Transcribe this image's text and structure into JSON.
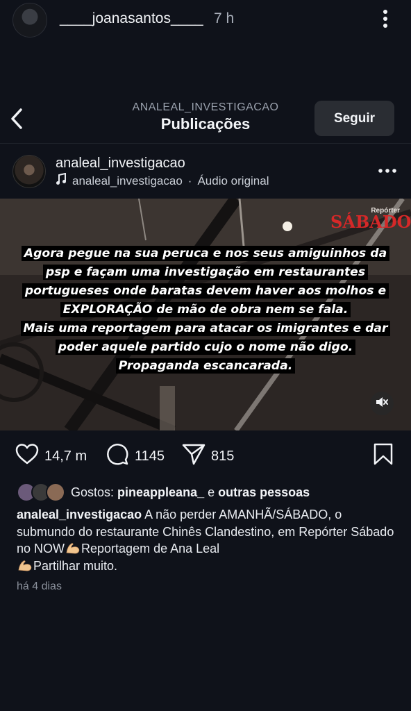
{
  "story": {
    "username": "____joanasantos____",
    "time": "7 h"
  },
  "screen": {
    "account": "ANALEAL_INVESTIGACAO",
    "title": "Publicações",
    "follow_label": "Seguir"
  },
  "post": {
    "username": "analeal_investigacao",
    "audio_user": "analeal_investigacao",
    "audio_label": "Áudio original",
    "brand_small": "Repórter",
    "brand_main": "SÁBADO",
    "overlay_lines": [
      "Agora pegue na sua peruca e nos seus amiguinhos da",
      "psp e façam uma investigação em  restaurantes",
      "portugueses onde baratas devem  haver aos molhos e",
      "EXPLORAÇÃO de mão de obra nem se fala.",
      "Mais uma reportagem para atacar os imigrantes e dar",
      "poder aquele partido cujo o nome não digo.",
      "Propaganda escancarada."
    ],
    "likes_count": "14,7 m",
    "comments_count": "1145",
    "shares_count": "815",
    "likes_prefix": "Gostos:",
    "likes_user": "pineappleana_",
    "likes_and": "e",
    "likes_others": "outras pessoas",
    "caption_user": "analeal_investigacao",
    "caption_part1": "A não perder AMANHÃ/SÁBADO, o submundo do restaurante Chinês Clandestino, em Repórter Sábado no NOW",
    "caption_part2": "Reportagem de Ana Leal",
    "caption_part3": "Partilhar muito.",
    "date": "há 4 dias"
  },
  "icons": {
    "more": "more-vertical-icon",
    "back": "chevron-left-icon",
    "music": "music-note-icon",
    "like": "heart-icon",
    "comment": "comment-icon",
    "share": "send-icon",
    "save": "bookmark-icon",
    "mute": "muted-speaker-icon",
    "emoji": "flexed-biceps-emoji"
  },
  "colors": {
    "background": "#0f121a",
    "button": "#2a2d33",
    "brand_red": "#d62828"
  }
}
